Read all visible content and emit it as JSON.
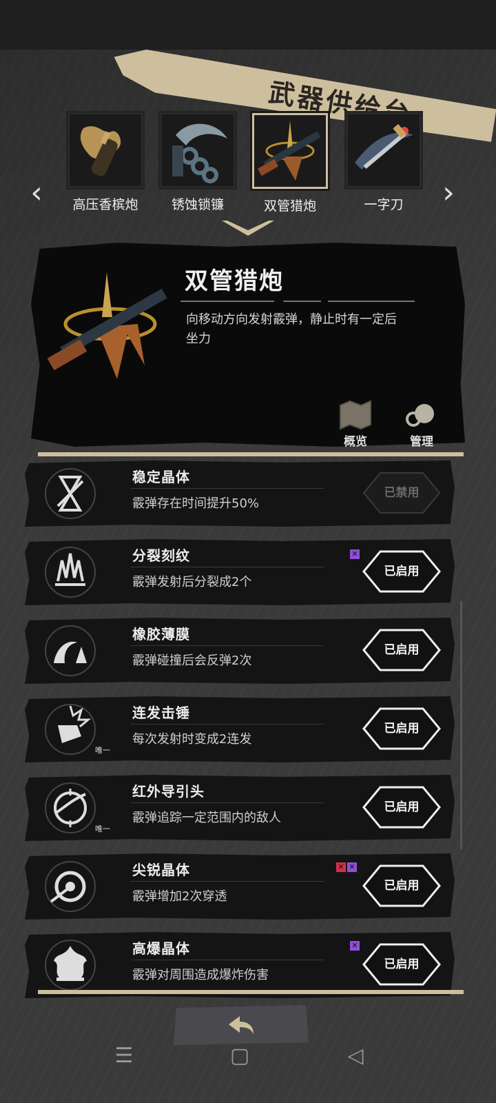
{
  "title": "武器供给台",
  "weapons": [
    {
      "name": "高压香槟炮",
      "icon": "champagne-cannon-icon"
    },
    {
      "name": "锈蚀锁镰",
      "icon": "rusty-chain-sickle-icon"
    },
    {
      "name": "双管猎炮",
      "icon": "double-barrel-shotgun-icon",
      "selected": true
    },
    {
      "name": "一字刀",
      "icon": "katana-icon"
    }
  ],
  "detail": {
    "name": "双管猎炮",
    "description": "向移动方向发射霰弹，静止时有一定后坐力",
    "overview_label": "概览",
    "manage_label": "管理"
  },
  "upgrades": [
    {
      "name": "稳定晶体",
      "desc": "霰弹存在时间提升50%",
      "state": "已禁用",
      "enabled": false,
      "icon": "hourglass-icon",
      "tags": [],
      "unique": ""
    },
    {
      "name": "分裂刻纹",
      "desc": "霰弹发射后分裂成2个",
      "state": "已启用",
      "enabled": true,
      "icon": "split-crown-icon",
      "tags": [
        "purple"
      ],
      "unique": ""
    },
    {
      "name": "橡胶薄膜",
      "desc": "霰弹碰撞后会反弹2次",
      "state": "已启用",
      "enabled": true,
      "icon": "bounce-wave-icon",
      "tags": [],
      "unique": ""
    },
    {
      "name": "连发击锤",
      "desc": "每次发射时变成2连发",
      "state": "已启用",
      "enabled": true,
      "icon": "hammer-burst-icon",
      "tags": [],
      "unique": "唯一"
    },
    {
      "name": "红外导引头",
      "desc": "霰弹追踪一定范围内的敌人",
      "state": "已启用",
      "enabled": true,
      "icon": "homing-target-icon",
      "tags": [],
      "unique": "唯一"
    },
    {
      "name": "尖锐晶体",
      "desc": "霰弹增加2次穿透",
      "state": "已启用",
      "enabled": true,
      "icon": "pierce-target-icon",
      "tags": [
        "red",
        "purple"
      ],
      "unique": ""
    },
    {
      "name": "高爆晶体",
      "desc": "霰弹对周围造成爆炸伤害",
      "state": "已启用",
      "enabled": true,
      "icon": "explosion-icon",
      "tags": [
        "purple"
      ],
      "unique": ""
    }
  ],
  "colors": {
    "accent": "#cdbf9e",
    "tag_purple": "#8f4fd6",
    "tag_red": "#d0304a",
    "panel": "#141414"
  }
}
